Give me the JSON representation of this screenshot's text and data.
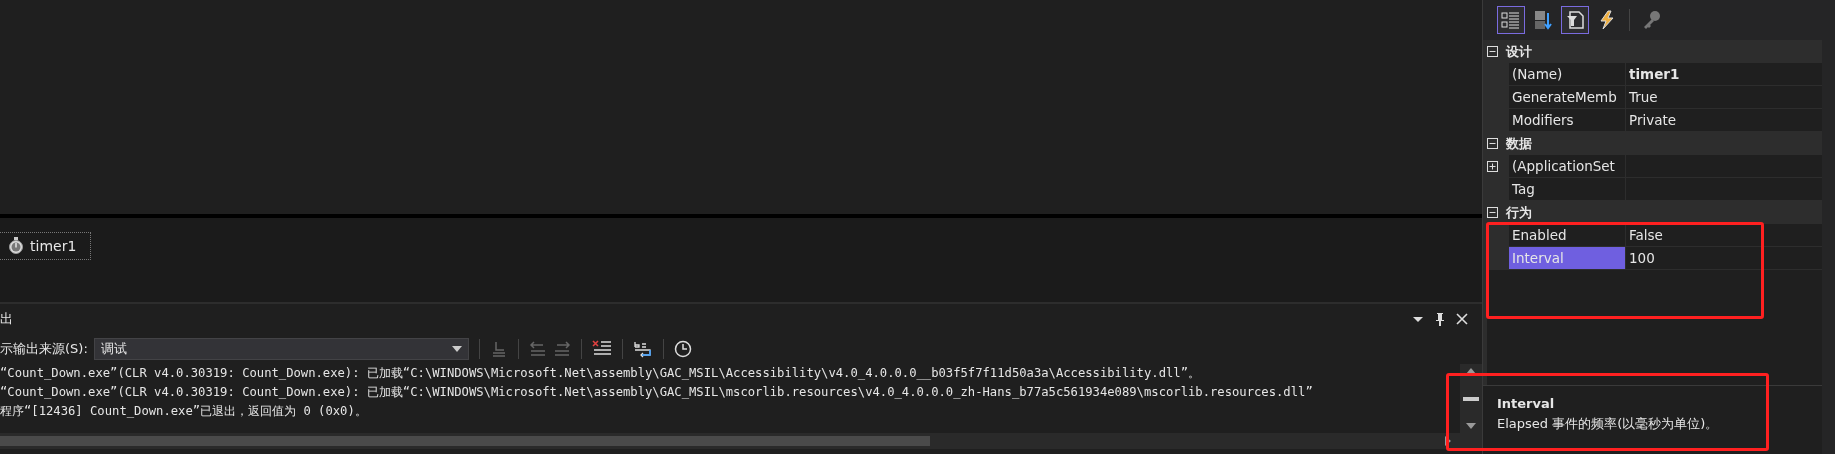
{
  "designer": {
    "tray_items": [
      {
        "label": "timer1"
      }
    ]
  },
  "output": {
    "title": "出",
    "source_label": "示输出来源(S):",
    "source_value": "调试",
    "lines": [
      "“Count_Down.exe”(CLR v4.0.30319: Count_Down.exe): 已加载“C:\\WINDOWS\\Microsoft.Net\\assembly\\GAC_MSIL\\Accessibility\\v4.0_4.0.0.0__b03f5f7f11d50a3a\\Accessibility.dll”。",
      "“Count_Down.exe”(CLR v4.0.30319: Count_Down.exe): 已加载“C:\\WINDOWS\\Microsoft.Net\\assembly\\GAC_MSIL\\mscorlib.resources\\v4.0_4.0.0.0_zh-Hans_b77a5c561934e089\\mscorlib.resources.dll”",
      "程序“[12436] Count_Down.exe”已退出，返回值为 0 (0x0)。"
    ]
  },
  "properties": {
    "toolbar": [
      {
        "kind": "categorized",
        "selected": true
      },
      {
        "kind": "alphabetical",
        "selected": false
      },
      {
        "kind": "properties",
        "selected": true
      },
      {
        "kind": "events",
        "selected": false
      },
      {
        "kind": "pages",
        "selected": false
      }
    ],
    "categories": [
      {
        "name": "设计",
        "expanded": true,
        "rows": [
          {
            "name": "(Name)",
            "value": "timer1",
            "bold": true,
            "expandable": false,
            "selected": false
          },
          {
            "name": "GenerateMemb",
            "value": "True",
            "bold": false,
            "expandable": false,
            "selected": false
          },
          {
            "name": "Modifiers",
            "value": "Private",
            "bold": false,
            "expandable": false,
            "selected": false
          }
        ]
      },
      {
        "name": "数据",
        "expanded": true,
        "rows": [
          {
            "name": "(ApplicationSet",
            "value": "",
            "bold": false,
            "expandable": true,
            "selected": false
          },
          {
            "name": "Tag",
            "value": "",
            "bold": false,
            "expandable": false,
            "selected": false
          }
        ]
      },
      {
        "name": "行为",
        "expanded": true,
        "rows": [
          {
            "name": "Enabled",
            "value": "False",
            "bold": false,
            "expandable": false,
            "selected": false
          },
          {
            "name": "Interval",
            "value": "100",
            "bold": false,
            "expandable": false,
            "selected": true
          }
        ]
      }
    ],
    "description": {
      "title": "Interval",
      "text": "Elapsed 事件的频率(以毫秒为单位)。"
    }
  }
}
